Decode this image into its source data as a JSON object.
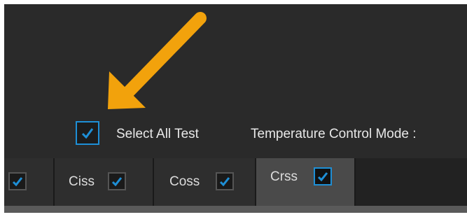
{
  "toolbar": {
    "select_all_label": "Select All Test",
    "select_all_checked": true,
    "temperature_mode_label": "Temperature Control Mode :"
  },
  "tabs": [
    {
      "label": "",
      "checked": true,
      "active": false
    },
    {
      "label": "Ciss",
      "checked": true,
      "active": false
    },
    {
      "label": "Coss",
      "checked": true,
      "active": false
    },
    {
      "label": "Crss",
      "checked": true,
      "active": true
    }
  ],
  "annotation": {
    "arrow_color": "#f2a20c"
  },
  "colors": {
    "background": "#2a2a2a",
    "accent": "#1e8fd6",
    "text": "#e8e8e8",
    "active_tab": "#4a4a4a"
  }
}
